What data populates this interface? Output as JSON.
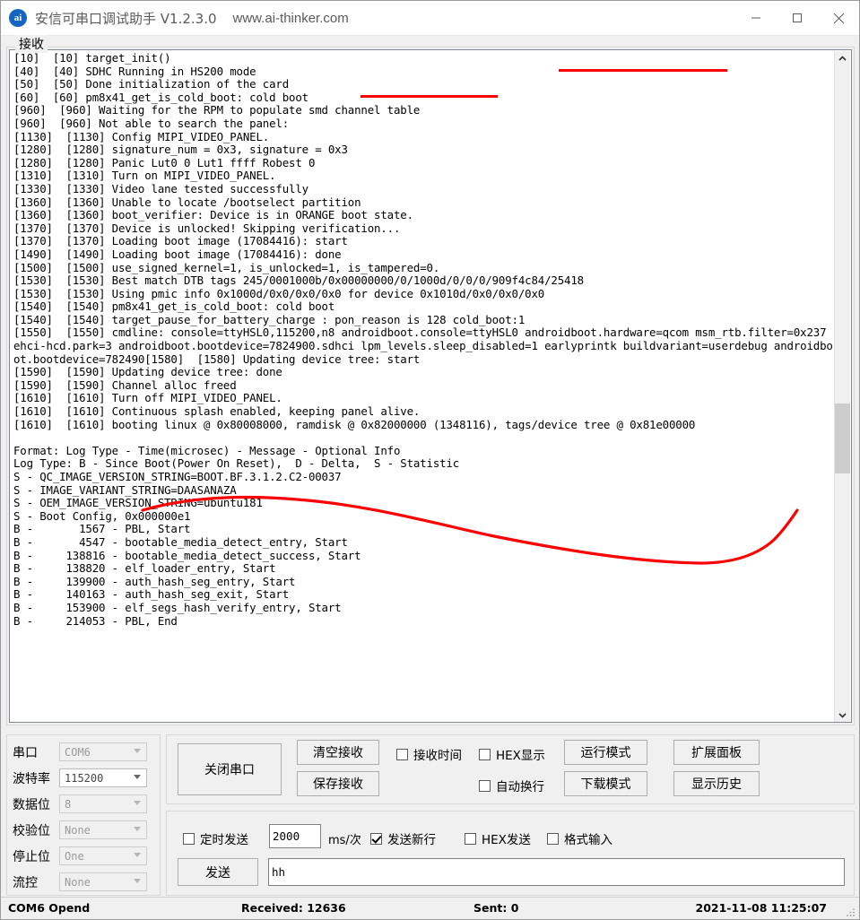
{
  "window": {
    "icon_text": "ai",
    "title": "安信可串口调试助手 V1.2.3.0",
    "url": "www.ai-thinker.com",
    "minimize": "—",
    "maximize": "☐",
    "close": "✕"
  },
  "receive": {
    "legend": "接收",
    "log": "[10]  [10] target_init()\n[40]  [40] SDHC Running in HS200 mode\n[50]  [50] Done initialization of the card\n[60]  [60] pm8x41_get_is_cold_boot: cold boot\n[960]  [960] Waiting for the RPM to populate smd channel table\n[960]  [960] Not able to search the panel:\n[1130]  [1130] Config MIPI_VIDEO_PANEL.\n[1280]  [1280] signature_num = 0x3, signature = 0x3\n[1280]  [1280] Panic Lut0 0 Lut1 ffff Robest 0\n[1310]  [1310] Turn on MIPI_VIDEO_PANEL.\n[1330]  [1330] Video lane tested successfully\n[1360]  [1360] Unable to locate /bootselect partition\n[1360]  [1360] boot_verifier: Device is in ORANGE boot state.\n[1370]  [1370] Device is unlocked! Skipping verification...\n[1370]  [1370] Loading boot image (17084416): start\n[1490]  [1490] Loading boot image (17084416): done\n[1500]  [1500] use_signed_kernel=1, is_unlocked=1, is_tampered=0.\n[1530]  [1530] Best match DTB tags 245/0001000b/0x00000000/0/1000d/0/0/0/909f4c84/25418\n[1530]  [1530] Using pmic info 0x1000d/0x0/0x0/0x0 for device 0x1010d/0x0/0x0/0x0\n[1540]  [1540] pm8x41_get_is_cold_boot: cold boot\n[1540]  [1540] target_pause_for_battery_charge : pon_reason is 128 cold_boot:1\n[1550]  [1550] cmdline: console=ttyHSL0,115200,n8 androidboot.console=ttyHSL0 androidboot.hardware=qcom msm_rtb.filter=0x237 ehci-hcd.park=3 androidboot.bootdevice=7824900.sdhci lpm_levels.sleep_disabled=1 earlyprintk buildvariant=userdebug androidboot.bootdevice=782490[1580]  [1580] Updating device tree: start\n[1590]  [1590] Updating device tree: done\n[1590]  [1590] Channel alloc freed\n[1610]  [1610] Turn off MIPI_VIDEO_PANEL.\n[1610]  [1610] Continuous splash enabled, keeping panel alive.\n[1610]  [1610] booting linux @ 0x80008000, ramdisk @ 0x82000000 (1348116), tags/device tree @ 0x81e00000\n\nFormat: Log Type - Time(microsec) - Message - Optional Info\nLog Type: B - Since Boot(Power On Reset),  D - Delta,  S - Statistic\nS - QC_IMAGE_VERSION_STRING=BOOT.BF.3.1.2.C2-00037\nS - IMAGE_VARIANT_STRING=DAASANAZA\nS - OEM_IMAGE_VERSION_STRING=ubuntu181\nS - Boot Config, 0x000000e1\nB -       1567 - PBL, Start\nB -       4547 - bootable_media_detect_entry, Start\nB -     138816 - bootable_media_detect_success, Start\nB -     138820 - elf_loader_entry, Start\nB -     139900 - auth_hash_seg_entry, Start\nB -     140163 - auth_hash_seg_exit, Start\nB -     153900 - elf_segs_hash_verify_entry, Start\nB -     214053 - PBL, End",
    "scroll_up": "⌃",
    "scroll_down": "⌄"
  },
  "annotations": {
    "accent_color": "#ff0000",
    "marks": [
      "underline-1",
      "underline-2",
      "freehand-curve"
    ]
  },
  "serial_settings": {
    "rows": [
      {
        "label": "串口",
        "value": "COM6",
        "name": "port",
        "active": false
      },
      {
        "label": "波特率",
        "value": "115200",
        "name": "baudrate",
        "active": true
      },
      {
        "label": "数据位",
        "value": "8",
        "name": "databits",
        "active": false
      },
      {
        "label": "校验位",
        "value": "None",
        "name": "parity",
        "active": false
      },
      {
        "label": "停止位",
        "value": "One",
        "name": "stopbits",
        "active": false
      },
      {
        "label": "流控",
        "value": "None",
        "name": "flowctrl",
        "active": false
      }
    ]
  },
  "controls": {
    "close_port": "关闭串口",
    "clear_recv": "清空接收",
    "save_recv": "保存接收",
    "recv_time": "接收时间",
    "hex_display": "HEX显示",
    "auto_wrap": "自动换行",
    "run_mode": "运行模式",
    "download_mode": "下载模式",
    "expand_panel": "扩展面板",
    "show_history": "显示历史",
    "recv_time_checked": false,
    "hex_display_checked": false,
    "auto_wrap_checked": false
  },
  "send": {
    "timed_send": "定时发送",
    "timed_send_checked": false,
    "interval_value": "2000",
    "interval_unit": "ms/次",
    "send_newline": "发送新行",
    "send_newline_checked": true,
    "hex_send": "HEX发送",
    "hex_send_checked": false,
    "format_input": "格式输入",
    "format_input_checked": false,
    "send_button": "发送",
    "send_text": "hh"
  },
  "status": {
    "port_state": "COM6 Opend",
    "received": "Received: 12636",
    "sent": "Sent: 0",
    "datetime": "2021-11-08 11:25:07"
  }
}
